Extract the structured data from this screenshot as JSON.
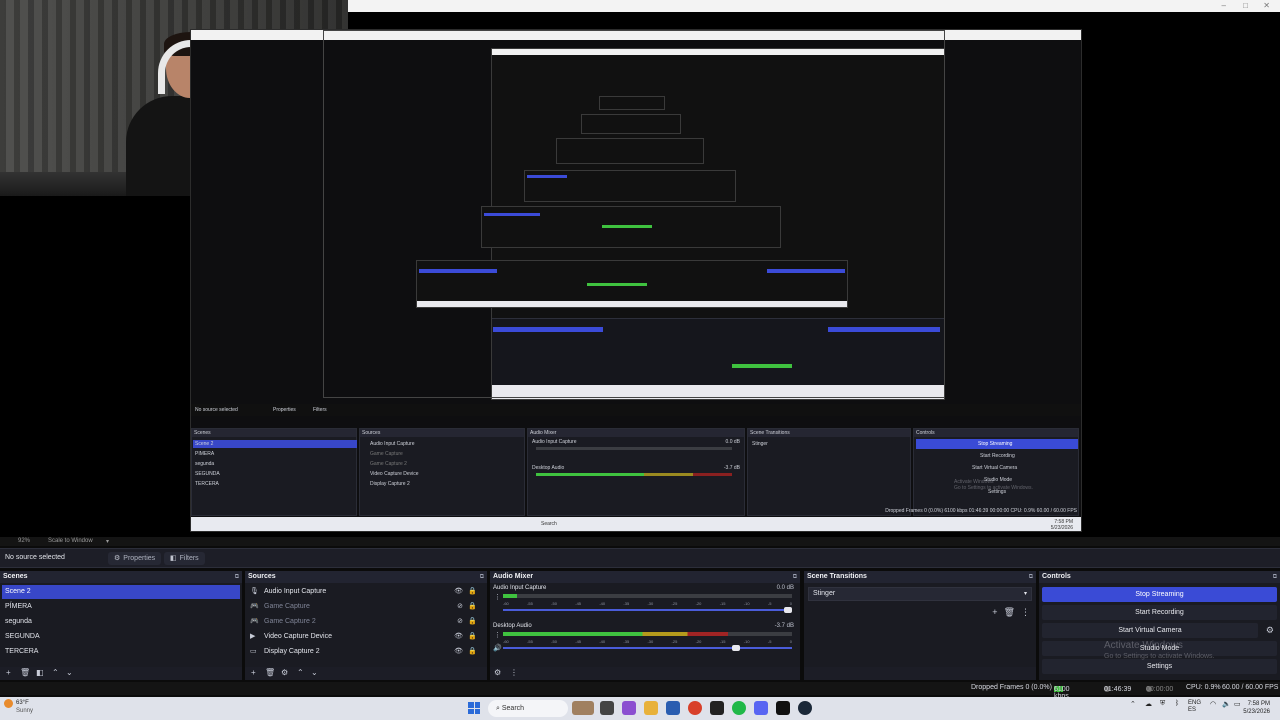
{
  "preview": {
    "scale_label": "92%",
    "scale_mode": "Scale to Window"
  },
  "nested_obs": {
    "no_source": "No source selected",
    "properties": "Properties",
    "filters": "Filters",
    "scenes_title": "Scenes",
    "scenes": [
      "Scene 2",
      "PIMERA",
      "segunda",
      "SEGUNDA",
      "TERCERA"
    ],
    "sources_title": "Sources",
    "sources": [
      "Audio Input Capture",
      "Game Capture",
      "Game Capture 2",
      "Video Capture Device",
      "Display Capture 2"
    ],
    "mixer_title": "Audio Mixer",
    "mixer_channels": [
      "Audio Input Capture",
      "Desktop Audio"
    ],
    "mixer_db": [
      "0.0 dB",
      "-3.7 dB"
    ],
    "transitions_title": "Scene Transitions",
    "transition": "Stinger",
    "controls_title": "Controls",
    "controls": [
      "Stop Streaming",
      "Start Recording",
      "Start Virtual Camera",
      "Studio Mode",
      "Settings"
    ],
    "activate_line1": "Activate Windows",
    "activate_line2": "Go to Settings to activate Windows.",
    "status": "Dropped Frames 0 (0.0%)   6100 kbps   01:46:39   00:00:00   CPU: 0.9%   60.00 / 60.00 FPS",
    "taskbar_search": "Search",
    "clock_time": "7:58 PM",
    "clock_date": "5/23/2026"
  },
  "context_bar": {
    "no_source": "No source selected",
    "properties_label": "Properties",
    "filters_label": "Filters",
    "properties_icon": "gear-icon",
    "filters_icon": "filter-icon"
  },
  "scenes": {
    "title": "Scenes",
    "items": [
      "Scene 2",
      "PÍMERA",
      "segunda",
      "SEGUNDA",
      "TERCERA"
    ],
    "selected": "Scene 2",
    "footer_icons": [
      "add-icon",
      "remove-icon",
      "filter-icon",
      "up-icon",
      "down-icon"
    ]
  },
  "sources": {
    "title": "Sources",
    "items": [
      {
        "name": "Audio Input Capture",
        "icon": "mic-icon",
        "visible": true
      },
      {
        "name": "Game Capture",
        "icon": "gamepad-icon",
        "visible": false
      },
      {
        "name": "Game Capture 2",
        "icon": "gamepad-icon",
        "visible": false
      },
      {
        "name": "Video Capture Device",
        "icon": "camera-icon",
        "visible": true
      },
      {
        "name": "Display Capture 2",
        "icon": "monitor-icon",
        "visible": true
      }
    ],
    "footer_icons": [
      "add-icon",
      "remove-icon",
      "gear-icon",
      "up-icon",
      "down-icon"
    ]
  },
  "audio_mixer": {
    "title": "Audio Mixer",
    "channels": [
      {
        "name": "Audio Input Capture",
        "db": "0.0 dB",
        "level": 0.05,
        "volume": 1.0
      },
      {
        "name": "Desktop Audio",
        "db": "-3.7 dB",
        "level": 0.78,
        "volume": 0.82
      }
    ],
    "ticks": [
      "-60",
      "-55",
      "-50",
      "-45",
      "-40",
      "-35",
      "-30",
      "-25",
      "-20",
      "-15",
      "-10",
      "-5",
      "0"
    ]
  },
  "scene_transitions": {
    "title": "Scene Transitions",
    "selected": "Stinger"
  },
  "controls": {
    "title": "Controls",
    "stop_streaming": "Stop Streaming",
    "start_recording": "Start Recording",
    "start_virtual_camera": "Start Virtual Camera",
    "studio_mode": "Studio Mode",
    "settings": "Settings"
  },
  "watermark": {
    "line1": "Activate Windows",
    "line2": "Go to Settings to activate Windows."
  },
  "status_bar": {
    "dropped_frames": "Dropped Frames 0 (0.0%)",
    "bitrate": "6100 kbps",
    "stream_time": "01:46:39",
    "record_time": "00:00:00",
    "cpu": "CPU: 0.9%",
    "fps": "60.00 / 60.00 FPS"
  },
  "taskbar": {
    "temperature": "63°F",
    "weather": "Sunny",
    "search": "Search",
    "lang_top": "ENG",
    "lang_bottom": "ES",
    "time": "7:58 PM",
    "date": "5/23/2026",
    "colors": {
      "accent": "#3847c8",
      "obs_bg": "#1a1b22"
    }
  }
}
